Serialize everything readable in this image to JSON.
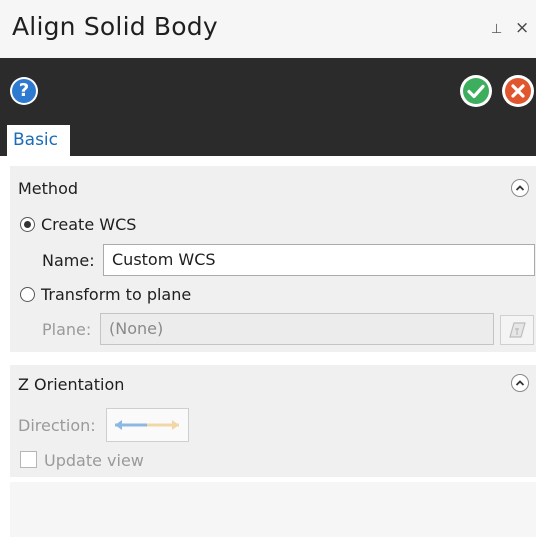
{
  "window": {
    "title": "Align Solid Body",
    "pin_glyph": "⊥",
    "close_glyph": "×"
  },
  "toolbar": {
    "help_glyph": "?",
    "ok_icon": "checkmark-icon",
    "cancel_icon": "x-icon",
    "colors": {
      "background": "#2b2b2b",
      "help": "#2f7ad1",
      "ok": "#3cae5e",
      "cancel": "#e0572f"
    }
  },
  "tabs": [
    {
      "label": "Basic",
      "active": true
    }
  ],
  "method": {
    "title": "Method",
    "options": [
      {
        "label": "Create WCS",
        "selected": true
      },
      {
        "label": "Transform to plane",
        "selected": false
      }
    ],
    "name_label": "Name:",
    "name_value": "Custom WCS",
    "plane_label": "Plane:",
    "plane_value": "(None)"
  },
  "z_orientation": {
    "title": "Z Orientation",
    "direction_label": "Direction:",
    "update_view_label": "Update view",
    "update_view_checked": false
  }
}
